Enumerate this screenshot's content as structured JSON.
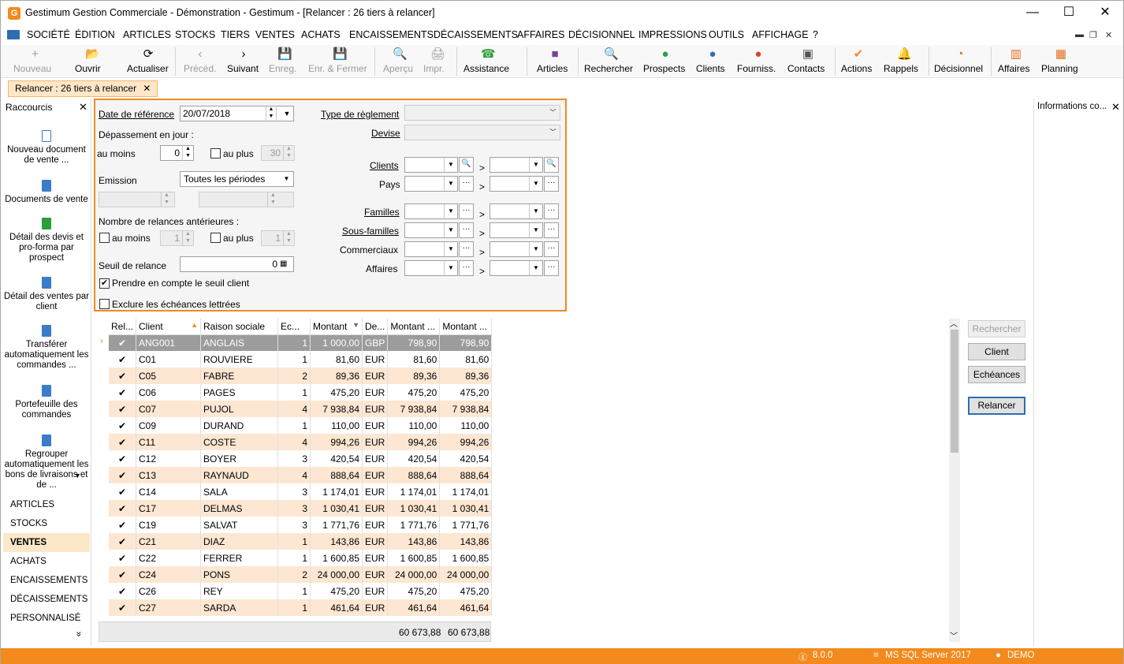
{
  "window": {
    "title": "Gestimum Gestion Commerciale - Démonstration - Gestimum - [Relancer : 26 tiers à relancer]",
    "app_icon": "G",
    "minimize": "—",
    "maximize": "☐",
    "close": "✕"
  },
  "menu": [
    "SOCIÉTÉ",
    "ÉDITION",
    "ARTICLES",
    "STOCKS",
    "TIERS",
    "VENTES",
    "ACHATS",
    "ENCAISSEMENTS",
    "DÉCAISSEMENTS",
    "AFFAIRES",
    "DÉCISIONNEL",
    "IMPRESSIONS",
    "OUTILS",
    "AFFICHAGE",
    "?"
  ],
  "mdi": {
    "min": "▬",
    "restore": "❐",
    "close": "✕"
  },
  "toolbar": {
    "left": [
      {
        "label": "Nouveau",
        "icon": "+",
        "disabled": true
      },
      {
        "label": "Ouvrir",
        "icon": "📂",
        "disabled": false
      },
      {
        "label": "Actualiser",
        "icon": "⟳",
        "disabled": false
      },
      {
        "label": "Précéd.",
        "icon": "‹",
        "disabled": true
      },
      {
        "label": "Suivant",
        "icon": "›",
        "disabled": false
      },
      {
        "label": "Enreg.",
        "icon": "💾",
        "disabled": true
      },
      {
        "label": "Enr. & Fermer",
        "icon": "💾",
        "disabled": true
      },
      {
        "label": "Aperçu",
        "icon": "🔍",
        "disabled": true
      },
      {
        "label": "Impr.",
        "icon": "🖨",
        "disabled": true
      },
      {
        "label": "Assistance",
        "icon": "☎",
        "disabled": false
      }
    ],
    "right": [
      {
        "label": "Articles",
        "icon": "■",
        "color": "#7b3fa0"
      },
      {
        "label": "Rechercher",
        "icon": "🔍",
        "color": "#444"
      },
      {
        "label": "Prospects",
        "icon": "●",
        "color": "#2e9e3e"
      },
      {
        "label": "Clients",
        "icon": "●",
        "color": "#2e6db4"
      },
      {
        "label": "Fourniss.",
        "icon": "●",
        "color": "#d9432f"
      },
      {
        "label": "Contacts",
        "icon": "▣",
        "color": "#555"
      },
      {
        "label": "Actions",
        "icon": "✔",
        "color": "#f28a1d"
      },
      {
        "label": "Rappels",
        "icon": "🔔",
        "color": "#f28a1d"
      },
      {
        "label": "Décisionnel",
        "icon": "◔",
        "color": "#e36b1c"
      },
      {
        "label": "Affaires",
        "icon": "▥",
        "color": "#e36b1c"
      },
      {
        "label": "Planning",
        "icon": "▦",
        "color": "#e36b1c"
      }
    ]
  },
  "tab": {
    "label": "Relancer : 26 tiers à relancer",
    "close": "✕"
  },
  "shortcuts": {
    "title": "Raccourcis",
    "close": "✕",
    "items": [
      "Nouveau document de vente ...",
      "Documents de vente",
      "Détail des devis et pro-forma par prospect",
      "Détail des ventes par client",
      "Transférer automatiquement les commandes ...",
      "Portefeuille des commandes",
      "Regrouper automatiquement les bons de livraisons et de ..."
    ],
    "nav": [
      "ARTICLES",
      "STOCKS",
      "VENTES",
      "ACHATS",
      "ENCAISSEMENTS",
      "DÉCAISSEMENTS",
      "PERSONNALISÉ"
    ],
    "active": "VENTES",
    "more": "»"
  },
  "info_panel": {
    "title": "Informations co...",
    "close": "✕"
  },
  "filter": {
    "date_label": "Date de référence",
    "date_value": "20/07/2018",
    "depassement_label": "Dépassement en jour :",
    "au_moins_label": "au moins",
    "au_moins_value": "0",
    "au_plus_label": "au plus",
    "au_plus_value": "30",
    "emission_label": "Emission",
    "emission_value": "Toutes les périodes",
    "nb_relances_label": "Nombre de relances antérieures :",
    "rel_au_moins_label": "au moins",
    "rel_au_moins_value": "1",
    "rel_au_plus_label": "au plus",
    "rel_au_plus_value": "1",
    "seuil_label": "Seuil de relance",
    "seuil_value": "0",
    "prendre_label": "Prendre en compte le seuil client",
    "exclure_label": "Exclure les échéances lettrées",
    "type_reglement_label": "Type de règlement",
    "devise_label": "Devise",
    "clients_label": "Clients",
    "pays_label": "Pays",
    "familles_label": "Familles",
    "sous_familles_label": "Sous-familles",
    "commerciaux_label": "Commerciaux",
    "affaires_label": "Affaires",
    "gt": ">"
  },
  "grid": {
    "headers": [
      "Rel...",
      "Client",
      "Raison sociale",
      "Ec...",
      "Montant",
      "De...",
      "Montant ...",
      "Montant ..."
    ],
    "rows": [
      {
        "client": "ANG001",
        "raison": "ANGLAIS",
        "ec": "1",
        "montant": "1 000,00",
        "devise": "GBP",
        "m2": "798,90",
        "m3": "798,90"
      },
      {
        "client": "C01",
        "raison": "ROUVIERE",
        "ec": "1",
        "montant": "81,60",
        "devise": "EUR",
        "m2": "81,60",
        "m3": "81,60"
      },
      {
        "client": "C05",
        "raison": "FABRE",
        "ec": "2",
        "montant": "89,36",
        "devise": "EUR",
        "m2": "89,36",
        "m3": "89,36"
      },
      {
        "client": "C06",
        "raison": "PAGES",
        "ec": "1",
        "montant": "475,20",
        "devise": "EUR",
        "m2": "475,20",
        "m3": "475,20"
      },
      {
        "client": "C07",
        "raison": "PUJOL",
        "ec": "4",
        "montant": "7 938,84",
        "devise": "EUR",
        "m2": "7 938,84",
        "m3": "7 938,84"
      },
      {
        "client": "C09",
        "raison": "DURAND",
        "ec": "1",
        "montant": "110,00",
        "devise": "EUR",
        "m2": "110,00",
        "m3": "110,00"
      },
      {
        "client": "C11",
        "raison": "COSTE",
        "ec": "4",
        "montant": "994,26",
        "devise": "EUR",
        "m2": "994,26",
        "m3": "994,26"
      },
      {
        "client": "C12",
        "raison": "BOYER",
        "ec": "3",
        "montant": "420,54",
        "devise": "EUR",
        "m2": "420,54",
        "m3": "420,54"
      },
      {
        "client": "C13",
        "raison": "RAYNAUD",
        "ec": "4",
        "montant": "888,64",
        "devise": "EUR",
        "m2": "888,64",
        "m3": "888,64"
      },
      {
        "client": "C14",
        "raison": "SALA",
        "ec": "3",
        "montant": "1 174,01",
        "devise": "EUR",
        "m2": "1 174,01",
        "m3": "1 174,01"
      },
      {
        "client": "C17",
        "raison": "DELMAS",
        "ec": "3",
        "montant": "1 030,41",
        "devise": "EUR",
        "m2": "1 030,41",
        "m3": "1 030,41"
      },
      {
        "client": "C19",
        "raison": "SALVAT",
        "ec": "3",
        "montant": "1 771,76",
        "devise": "EUR",
        "m2": "1 771,76",
        "m3": "1 771,76"
      },
      {
        "client": "C21",
        "raison": "DIAZ",
        "ec": "1",
        "montant": "143,86",
        "devise": "EUR",
        "m2": "143,86",
        "m3": "143,86"
      },
      {
        "client": "C22",
        "raison": "FERRER",
        "ec": "1",
        "montant": "1 600,85",
        "devise": "EUR",
        "m2": "1 600,85",
        "m3": "1 600,85"
      },
      {
        "client": "C24",
        "raison": "PONS",
        "ec": "2",
        "montant": "24 000,00",
        "devise": "EUR",
        "m2": "24 000,00",
        "m3": "24 000,00"
      },
      {
        "client": "C26",
        "raison": "REY",
        "ec": "1",
        "montant": "475,20",
        "devise": "EUR",
        "m2": "475,20",
        "m3": "475,20"
      },
      {
        "client": "C27",
        "raison": "SARDA",
        "ec": "1",
        "montant": "461,64",
        "devise": "EUR",
        "m2": "461,64",
        "m3": "461,64"
      }
    ],
    "total1": "60 673,88",
    "total2": "60 673,88",
    "check": "✔",
    "row_indicator": "›",
    "scroll_up": "︿",
    "scroll_down": "﹀"
  },
  "side_buttons": [
    "Rechercher",
    "Client",
    "Echéances",
    "Relancer"
  ],
  "status": {
    "version": "8.0.0",
    "db": "MS SQL Server 2017",
    "user": "DEMO"
  }
}
